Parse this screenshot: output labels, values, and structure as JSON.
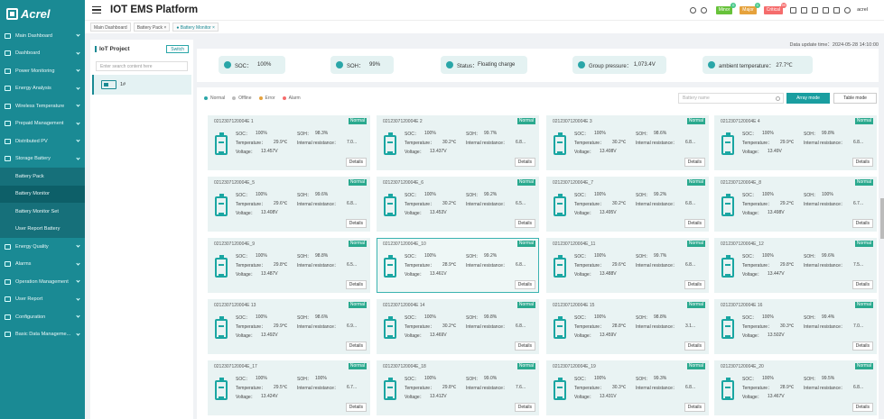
{
  "brand": {
    "logo_text": "Acrel"
  },
  "header": {
    "title": "IOT EMS Platform",
    "user": "acrel",
    "alarms": [
      {
        "label": "Minor",
        "count": "0",
        "color": "#67c23a"
      },
      {
        "label": "Major",
        "count": "0",
        "color": "#e6a23c"
      },
      {
        "label": "Critical",
        "count": "99",
        "color": "#f56c6c"
      }
    ]
  },
  "tabs": [
    {
      "label": "Main Dashboard"
    },
    {
      "label": "Battery Pack ×"
    },
    {
      "label": "● Battery Monitor ×"
    }
  ],
  "sidebar": {
    "items": [
      {
        "label": "Main Dashboard",
        "type": "top"
      },
      {
        "label": "Dashboard",
        "type": "top"
      },
      {
        "label": "Power Monitoring",
        "type": "top"
      },
      {
        "label": "Energy Analysis",
        "type": "top"
      },
      {
        "label": "Wireless Temperature",
        "type": "top"
      },
      {
        "label": "Prepaid Management",
        "type": "top"
      },
      {
        "label": "Distributed PV",
        "type": "top"
      },
      {
        "label": "Storage Battery",
        "type": "top"
      },
      {
        "label": "Battery Pack",
        "type": "sub"
      },
      {
        "label": "Battery Monitor",
        "type": "sub",
        "active": true
      },
      {
        "label": "Battery Monitor Set",
        "type": "sub"
      },
      {
        "label": "User Report Battery",
        "type": "sub"
      },
      {
        "label": "Energy Quality",
        "type": "top"
      },
      {
        "label": "Alarms",
        "type": "top"
      },
      {
        "label": "Operation Management",
        "type": "top"
      },
      {
        "label": "User Report",
        "type": "top"
      },
      {
        "label": "Configuration",
        "type": "top"
      },
      {
        "label": "Basic Data Manageme...",
        "type": "top"
      }
    ]
  },
  "left_panel": {
    "title": "IoT Project",
    "switch_label": "Switch",
    "search_placeholder": "Enter search content here",
    "tree_item": "1#"
  },
  "update_time": "Data update time：2024-05-28 14:10:00",
  "summary": {
    "soc_label": "SOC：",
    "soc_value": "100%",
    "soh_label": "SOH：",
    "soh_value": "99%",
    "status_label": "Status：",
    "status_value": "Floating charge",
    "group_pressure_label": "Group pressure：",
    "group_pressure_value": "1,073.4V",
    "ambient_label": "ambient temperature：",
    "ambient_value": "27.7℃"
  },
  "legend": [
    {
      "label": "Normal",
      "color": "#2aa6a8"
    },
    {
      "label": "Offline",
      "color": "#bbbbbb"
    },
    {
      "label": "Error",
      "color": "#e6a23c"
    },
    {
      "label": "Alarm",
      "color": "#f56c6c"
    }
  ],
  "device_search": {
    "placeholder": "Battery name"
  },
  "view_buttons": {
    "array": "Array mode",
    "table": "Table mode"
  },
  "card_labels": {
    "soc": "SOC：",
    "soh": "SOH：",
    "temperature": "Temperature：",
    "resistance": "Internal resistance：",
    "voltage": "Voltage：",
    "details": "Details"
  },
  "batteries": [
    {
      "name": "0212307120004E 1",
      "status": "Normal",
      "soc": "100%",
      "soh": "98.3%",
      "temp": "29.9℃",
      "res": "7.0...",
      "volt": "13.457V"
    },
    {
      "name": "0212307120004E 2",
      "status": "Normal",
      "soc": "100%",
      "soh": "99.7%",
      "temp": "30.2℃",
      "res": "6.8...",
      "volt": "13.437V"
    },
    {
      "name": "0212307120004E 3",
      "status": "Normal",
      "soc": "100%",
      "soh": "98.6%",
      "temp": "30.2℃",
      "res": "6.8...",
      "volt": "13.408V"
    },
    {
      "name": "0212307120004E 4",
      "status": "Normal",
      "soc": "100%",
      "soh": "99.8%",
      "temp": "29.9℃",
      "res": "6.8...",
      "volt": "13.49V"
    },
    {
      "name": "0212307120004E_5",
      "status": "Normal",
      "soc": "100%",
      "soh": "99.6%",
      "temp": "29.6℃",
      "res": "6.8...",
      "volt": "13.408V"
    },
    {
      "name": "0212307120004E_6",
      "status": "Normal",
      "soc": "100%",
      "soh": "99.2%",
      "temp": "30.2℃",
      "res": "6.5...",
      "volt": "13.453V"
    },
    {
      "name": "0212307120004E_7",
      "status": "Normal",
      "soc": "100%",
      "soh": "99.2%",
      "temp": "30.2℃",
      "res": "6.8...",
      "volt": "13.495V"
    },
    {
      "name": "0212307120004E_8",
      "status": "Normal",
      "soc": "100%",
      "soh": "100%",
      "temp": "29.2℃",
      "res": "6.7...",
      "volt": "13.498V"
    },
    {
      "name": "0212307120004E_9",
      "status": "Normal",
      "soc": "100%",
      "soh": "98.8%",
      "temp": "29.8℃",
      "res": "6.5...",
      "volt": "13.487V"
    },
    {
      "name": "0212307120004E_10",
      "status": "Normal",
      "soc": "100%",
      "soh": "99.2%",
      "temp": "28.9℃",
      "res": "6.8...",
      "volt": "13.461V"
    },
    {
      "name": "0212307120004E_11",
      "status": "Normal",
      "soc": "100%",
      "soh": "99.7%",
      "temp": "29.6℃",
      "res": "6.8...",
      "volt": "13.488V"
    },
    {
      "name": "0212307120004E_12",
      "status": "Normal",
      "soc": "100%",
      "soh": "99.6%",
      "temp": "29.8℃",
      "res": "7.5...",
      "volt": "13.447V"
    },
    {
      "name": "0212307120004E 13",
      "status": "Normal",
      "soc": "100%",
      "soh": "98.6%",
      "temp": "29.9℃",
      "res": "6.9...",
      "volt": "13.492V"
    },
    {
      "name": "0212307120004E 14",
      "status": "Normal",
      "soc": "100%",
      "soh": "99.8%",
      "temp": "30.2℃",
      "res": "6.8...",
      "volt": "13.469V"
    },
    {
      "name": "0212307120004E 15",
      "status": "Normal",
      "soc": "100%",
      "soh": "98.8%",
      "temp": "28.8℃",
      "res": "3.1...",
      "volt": "13.459V"
    },
    {
      "name": "0212307120004E 16",
      "status": "Normal",
      "soc": "100%",
      "soh": "99.4%",
      "temp": "30.3℃",
      "res": "7.0...",
      "volt": "13.502V"
    },
    {
      "name": "0212307120004E_17",
      "status": "Normal",
      "soc": "100%",
      "soh": "100%",
      "temp": "29.5℃",
      "res": "6.7...",
      "volt": "13.424V"
    },
    {
      "name": "0212307120004E_18",
      "status": "Normal",
      "soc": "100%",
      "soh": "99.0%",
      "temp": "29.8℃",
      "res": "7.6...",
      "volt": "13.412V"
    },
    {
      "name": "0212307120004E_19",
      "status": "Normal",
      "soc": "100%",
      "soh": "99.3%",
      "temp": "30.3℃",
      "res": "6.8...",
      "volt": "13.431V"
    },
    {
      "name": "0212307120004E_20",
      "status": "Normal",
      "soc": "100%",
      "soh": "99.5%",
      "temp": "28.9℃",
      "res": "6.8...",
      "volt": "13.467V"
    }
  ]
}
